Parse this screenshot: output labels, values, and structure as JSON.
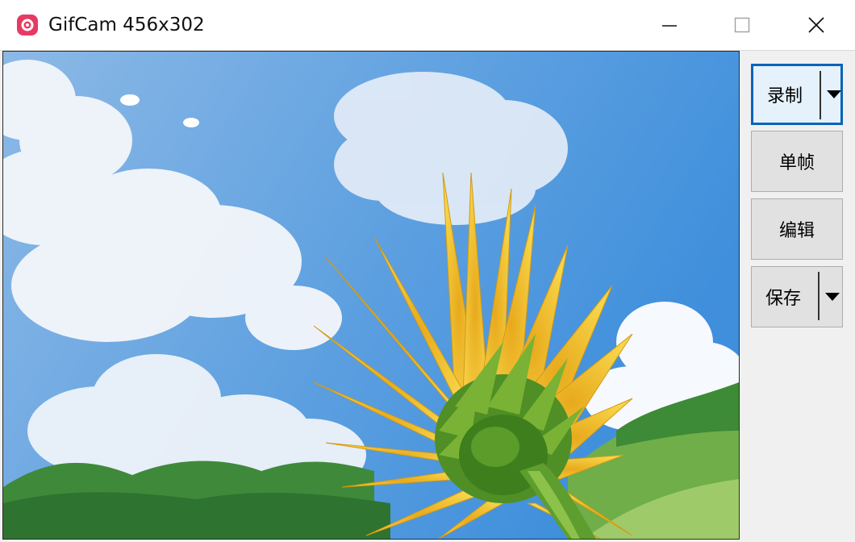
{
  "window": {
    "title": "GifCam 456x302",
    "app_icon": "camera-icon",
    "controls": [
      "minimize-icon",
      "maximize-icon",
      "close-icon"
    ],
    "accent_color": "#e63a63"
  },
  "capture_area": {
    "description_icon": "capture-preview",
    "sky_color": "#6aa6e0",
    "flower_color": "#f2c230"
  },
  "toolbar": {
    "record_label": "录制",
    "frame_label": "单帧",
    "edit_label": "编辑",
    "save_label": "保存",
    "dropdown_icon": "triangle-down-icon",
    "focus_color": "#0a64b8"
  }
}
